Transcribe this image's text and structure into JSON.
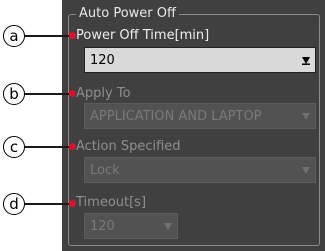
{
  "group": {
    "title": "Auto Power Off"
  },
  "callouts": [
    {
      "letter": "a"
    },
    {
      "letter": "b"
    },
    {
      "letter": "c"
    },
    {
      "letter": "d"
    }
  ],
  "fields": {
    "power_off_time": {
      "label": "Power Off Time[min]",
      "value": "120",
      "enabled": true
    },
    "apply_to": {
      "label": "Apply To",
      "value": "APPLICATION AND LAPTOP",
      "enabled": false
    },
    "action_specified": {
      "label": "Action Specified",
      "value": "Lock",
      "enabled": false
    },
    "timeout": {
      "label": "Timeout[s]",
      "value": "120",
      "enabled": false
    }
  },
  "colors": {
    "callout_dot": "#e0102a",
    "panel_bg": "#404040"
  },
  "icons": {
    "dropdown": "triangle-down-icon"
  }
}
